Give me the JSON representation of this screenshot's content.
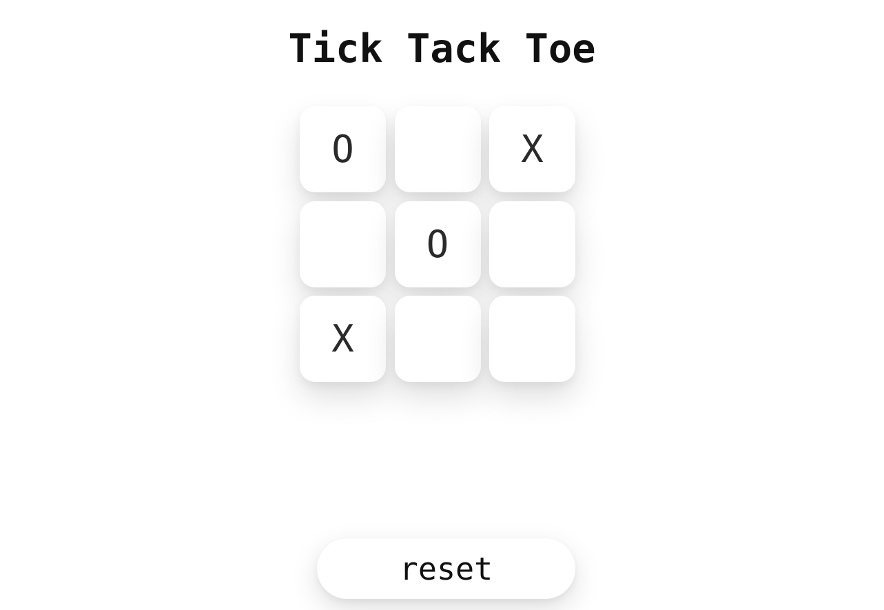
{
  "header": {
    "title": "Tick Tack Toe"
  },
  "board": {
    "cells": [
      "O",
      "",
      "X",
      "",
      "O",
      "",
      "X",
      "",
      ""
    ]
  },
  "controls": {
    "reset_label": "reset"
  }
}
